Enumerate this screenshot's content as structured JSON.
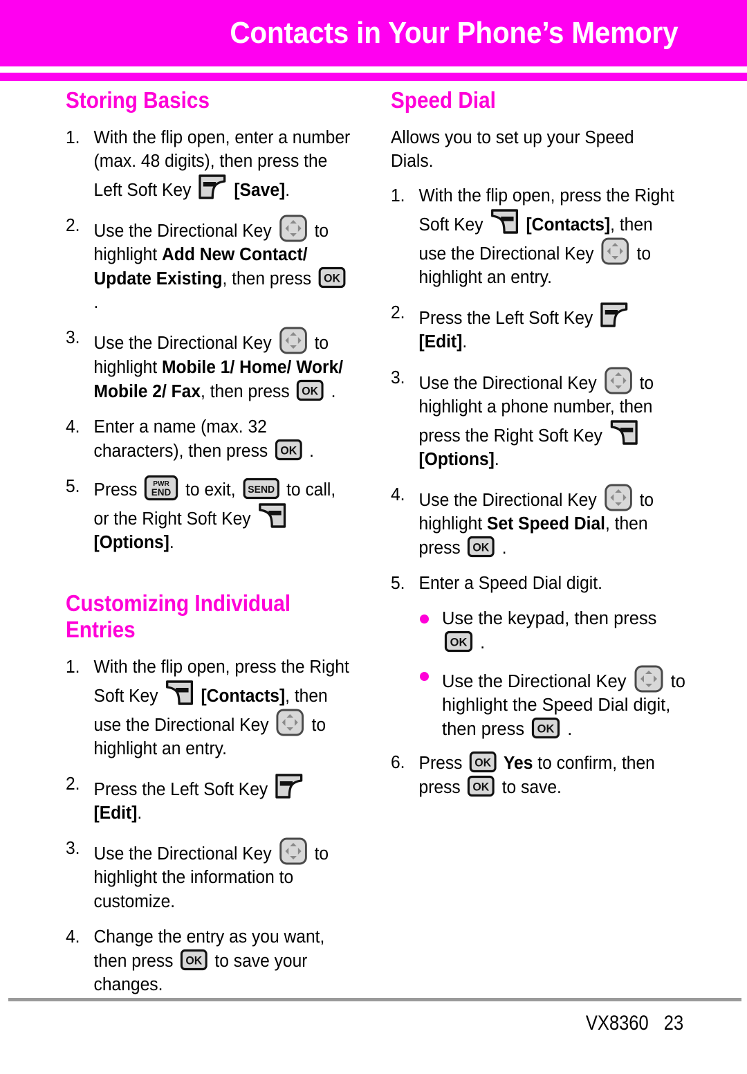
{
  "page": {
    "header_title": "Contacts in Your Phone’s Memory",
    "footer_model": "VX8360",
    "footer_page": "23",
    "accent_color": "#ff00f0",
    "heading_color": "#ff00d8",
    "bullet_color": "#ff00d8",
    "rule_color": "#9a9a9a"
  },
  "icons": {
    "left_soft_key": "left-soft-key-icon",
    "right_soft_key": "right-soft-key-icon",
    "directional_key": "directional-key-icon",
    "ok_key": "ok-key-icon",
    "pwr_end_key": "pwr-end-key-icon",
    "send_key": "send-key-icon",
    "ok_label": "OK",
    "pwr_label": "PWR",
    "end_label": "END",
    "send_label": "SEND"
  },
  "left_column": {
    "storing_basics": {
      "heading": "Storing Basics",
      "steps": [
        {
          "num": "1.",
          "parts": [
            {
              "t": "text",
              "v": "With the flip open, enter a number (max. 48 digits), then press the Left Soft Key "
            },
            {
              "t": "icon",
              "v": "left_soft_key"
            },
            {
              "t": "bold",
              "v": " [Save]"
            },
            {
              "t": "text",
              "v": "."
            }
          ]
        },
        {
          "num": "2.",
          "parts": [
            {
              "t": "text",
              "v": "Use the Directional Key "
            },
            {
              "t": "icon",
              "v": "directional_key"
            },
            {
              "t": "text",
              "v": " to highlight "
            },
            {
              "t": "bold",
              "v": "Add New Contact/ Update Existing"
            },
            {
              "t": "text",
              "v": ", then press "
            },
            {
              "t": "icon",
              "v": "ok_key"
            },
            {
              "t": "text",
              "v": " ."
            }
          ]
        },
        {
          "num": "3.",
          "parts": [
            {
              "t": "text",
              "v": "Use the Directional Key "
            },
            {
              "t": "icon",
              "v": "directional_key"
            },
            {
              "t": "text",
              "v": " to highlight "
            },
            {
              "t": "bold",
              "v": "Mobile 1/ Home/ Work/ Mobile 2/ Fax"
            },
            {
              "t": "text",
              "v": ", then press "
            },
            {
              "t": "icon",
              "v": "ok_key"
            },
            {
              "t": "text",
              "v": " ."
            }
          ]
        },
        {
          "num": "4.",
          "parts": [
            {
              "t": "text",
              "v": "Enter a name (max. 32 characters), then press "
            },
            {
              "t": "icon",
              "v": "ok_key"
            },
            {
              "t": "text",
              "v": " ."
            }
          ]
        },
        {
          "num": "5.",
          "parts": [
            {
              "t": "text",
              "v": "Press "
            },
            {
              "t": "icon",
              "v": "pwr_end_key"
            },
            {
              "t": "text",
              "v": " to exit, "
            },
            {
              "t": "icon",
              "v": "send_key"
            },
            {
              "t": "text",
              "v": " to call, or the Right Soft Key "
            },
            {
              "t": "icon",
              "v": "right_soft_key"
            },
            {
              "t": "bold",
              "v": " [Options]"
            },
            {
              "t": "text",
              "v": "."
            }
          ]
        }
      ]
    },
    "customizing_entries": {
      "heading": "Customizing Individual Entries",
      "steps": [
        {
          "num": "1.",
          "parts": [
            {
              "t": "text",
              "v": "With the flip open, press the Right Soft Key "
            },
            {
              "t": "icon",
              "v": "right_soft_key"
            },
            {
              "t": "bold",
              "v": " [Contacts]"
            },
            {
              "t": "text",
              "v": ", then use the Directional Key "
            },
            {
              "t": "icon",
              "v": "directional_key"
            },
            {
              "t": "text",
              "v": " to highlight an entry."
            }
          ]
        },
        {
          "num": "2.",
          "parts": [
            {
              "t": "text",
              "v": "Press the Left Soft Key "
            },
            {
              "t": "icon",
              "v": "left_soft_key"
            },
            {
              "t": "bold",
              "v": " [Edit]"
            },
            {
              "t": "text",
              "v": "."
            }
          ]
        },
        {
          "num": "3.",
          "parts": [
            {
              "t": "text",
              "v": "Use the Directional Key "
            },
            {
              "t": "icon",
              "v": "directional_key"
            },
            {
              "t": "text",
              "v": " to highlight the information to customize."
            }
          ]
        },
        {
          "num": "4.",
          "parts": [
            {
              "t": "text",
              "v": "Change the entry as you want, then press "
            },
            {
              "t": "icon",
              "v": "ok_key"
            },
            {
              "t": "text",
              "v": " to save your changes."
            }
          ]
        }
      ]
    }
  },
  "right_column": {
    "speed_dial": {
      "heading": "Speed Dial",
      "intro": "Allows you to set up your Speed Dials.",
      "steps": [
        {
          "num": "1.",
          "parts": [
            {
              "t": "text",
              "v": "With the flip open, press the Right Soft Key "
            },
            {
              "t": "icon",
              "v": "right_soft_key"
            },
            {
              "t": "bold",
              "v": " [Contacts]"
            },
            {
              "t": "text",
              "v": ", then use the Directional Key "
            },
            {
              "t": "icon",
              "v": "directional_key"
            },
            {
              "t": "text",
              "v": " to highlight an entry."
            }
          ]
        },
        {
          "num": "2.",
          "parts": [
            {
              "t": "text",
              "v": "Press the Left Soft Key "
            },
            {
              "t": "icon",
              "v": "left_soft_key"
            },
            {
              "t": "bold",
              "v": " [Edit]"
            },
            {
              "t": "text",
              "v": "."
            }
          ]
        },
        {
          "num": "3.",
          "parts": [
            {
              "t": "text",
              "v": "Use the Directional Key "
            },
            {
              "t": "icon",
              "v": "directional_key"
            },
            {
              "t": "text",
              "v": " to highlight a phone number, then press the Right Soft Key "
            },
            {
              "t": "icon",
              "v": "right_soft_key"
            },
            {
              "t": "bold",
              "v": " [Options]"
            },
            {
              "t": "text",
              "v": "."
            }
          ]
        },
        {
          "num": "4.",
          "parts": [
            {
              "t": "text",
              "v": "Use the Directional Key "
            },
            {
              "t": "icon",
              "v": "directional_key"
            },
            {
              "t": "text",
              "v": " to highlight "
            },
            {
              "t": "bold",
              "v": "Set Speed Dial"
            },
            {
              "t": "text",
              "v": ", then press "
            },
            {
              "t": "icon",
              "v": "ok_key"
            },
            {
              "t": "text",
              "v": " ."
            }
          ]
        },
        {
          "num": "5.",
          "parts": [
            {
              "t": "text",
              "v": "Enter a Speed Dial digit."
            }
          ],
          "bullets": [
            [
              {
                "t": "text",
                "v": "Use the keypad, then press "
              },
              {
                "t": "icon",
                "v": "ok_key"
              },
              {
                "t": "text",
                "v": " ."
              }
            ],
            [
              {
                "t": "text",
                "v": "Use the Directional Key "
              },
              {
                "t": "icon",
                "v": "directional_key"
              },
              {
                "t": "text",
                "v": " to highlight the Speed Dial digit, then press "
              },
              {
                "t": "icon",
                "v": "ok_key"
              },
              {
                "t": "text",
                "v": " ."
              }
            ]
          ]
        },
        {
          "num": "6.",
          "parts": [
            {
              "t": "text",
              "v": "Press "
            },
            {
              "t": "icon",
              "v": "ok_key"
            },
            {
              "t": "bold",
              "v": " Yes"
            },
            {
              "t": "text",
              "v": " to confirm, then press "
            },
            {
              "t": "icon",
              "v": "ok_key"
            },
            {
              "t": "text",
              "v": " to save."
            }
          ]
        }
      ]
    }
  }
}
